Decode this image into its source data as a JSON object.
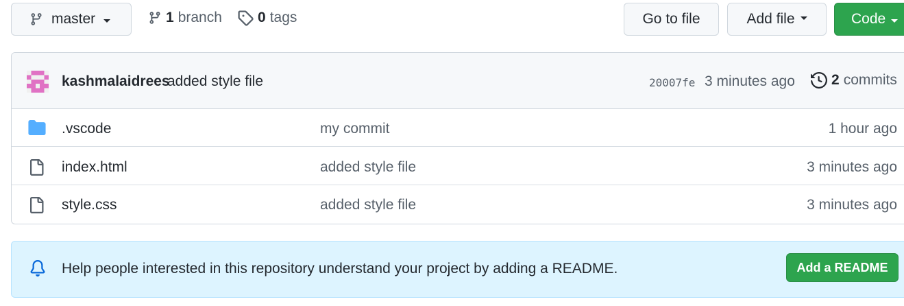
{
  "toolbar": {
    "branch_label": "master",
    "branch_count": "1",
    "branch_word": "branch",
    "tag_count": "0",
    "tag_word": "tags",
    "goto_label": "Go to file",
    "addfile_label": "Add file",
    "code_label": "Code"
  },
  "commit": {
    "author": "kashmalaidrees",
    "message": "added style file",
    "sha": "20007fe",
    "time": "3 minutes ago",
    "count": "2",
    "count_word": "commits"
  },
  "files": [
    {
      "name": ".vscode",
      "type": "folder",
      "message": "my commit",
      "age": "1 hour ago"
    },
    {
      "name": "index.html",
      "type": "file",
      "message": "added style file",
      "age": "3 minutes ago"
    },
    {
      "name": "style.css",
      "type": "file",
      "message": "added style file",
      "age": "3 minutes ago"
    }
  ],
  "readme_banner": {
    "text": "Help people interested in this repository understand your project by adding a README.",
    "button_label": "Add a README"
  },
  "icons": {
    "branch": "git-branch-icon",
    "tag": "tag-icon",
    "history": "history-icon",
    "folder": "folder-icon",
    "file": "file-icon",
    "bell": "bell-icon"
  },
  "colors": {
    "primary_green": "#2da44e",
    "folder_blue": "#54aeff",
    "banner_bg": "#ddf4ff",
    "avatar_pink": "#e072c4"
  }
}
